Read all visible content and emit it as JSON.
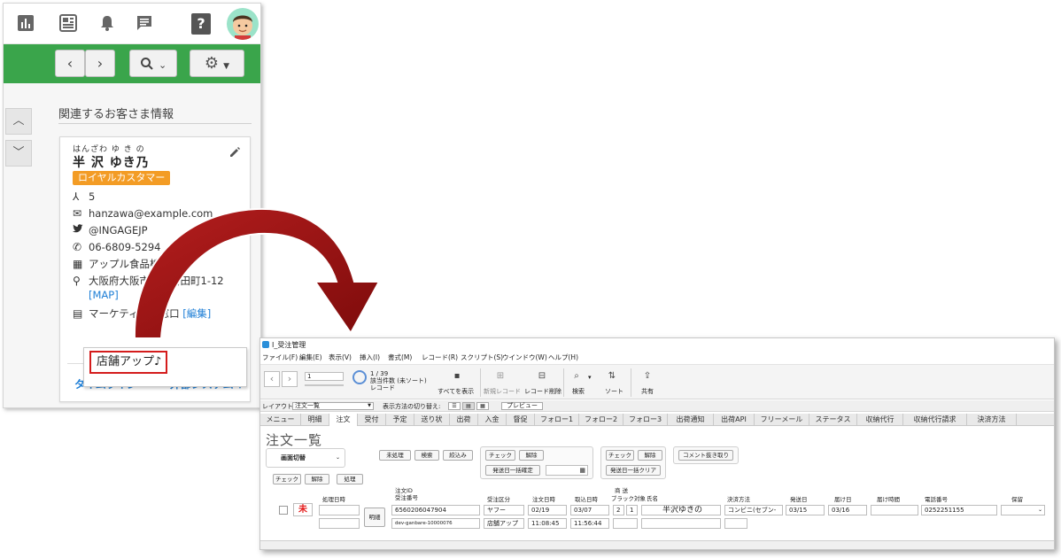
{
  "crm": {
    "help_label": "?",
    "section_title": "関連するお客さま情報",
    "customer": {
      "ruby": "はんざわ ゆ き の",
      "name": "半 沢 ゆき乃",
      "badge": "ロイヤルカスタマー",
      "count": "5",
      "email": "hanzawa@example.com",
      "twitter": "@INGAGEJP",
      "phone": "06-6809-5294",
      "company": "アップル食品株式会社",
      "address": "大阪府大阪市北区角田町1-12",
      "map_link": "[MAP]",
      "note": "マーケティング窓口",
      "edit_link": "[編集]"
    },
    "tabs": {
      "timeline": "タイムライン",
      "external": "外部システム"
    },
    "dropdown_item": "店舗アップ♪"
  },
  "fm": {
    "window_title": "I_受注管理",
    "menu": [
      "ファイル(F)",
      "編集(E)",
      "表示(V)",
      "挿入(I)",
      "書式(M)",
      "レコード(R)",
      "スクリプト(S)",
      "ウインドウ(W)",
      "ヘルプ(H)"
    ],
    "toolbar": {
      "record_value": "1",
      "count": "1 / 39",
      "found": "該当件数 (未ソート)",
      "record_label": "レコード",
      "show_all": "すべてを表示",
      "new_record": "新規レコード",
      "delete_record": "レコード削除",
      "find": "検索",
      "sort": "ソート",
      "share": "共有"
    },
    "layout_label": "レイアウト:",
    "layout_value": "注文一覧",
    "view_label": "表示方法の切り替え:",
    "preview": "プレビュー",
    "tabs": [
      "メニュー",
      "明細",
      "注文",
      "受付",
      "予定",
      "送り状",
      "出荷",
      "入金",
      "督促",
      "フォロー1",
      "フォロー2",
      "フォロー3",
      "出荷通知",
      "出荷API",
      "フリーメール",
      "ステータス",
      "収納代行",
      "収納代行請求",
      "決済方法"
    ],
    "heading": "注文一覧",
    "buttons": {
      "screen_switch": "画面切替",
      "check": "チェック",
      "release": "解除",
      "process": "処理",
      "unprocessed": "未処理",
      "search": "検索",
      "narrow": "絞込み",
      "group_check": "チェック",
      "group_release": "解除",
      "ship_date_confirm": "発送日一括確定",
      "group2_check": "チェック",
      "group2_release": "解除",
      "ship_date_clear": "発送日一括クリア",
      "comment_extract": "コメント抜き取り",
      "detail": "明細"
    },
    "headers": {
      "processed_at": "処理日時",
      "order_id": "注文ID",
      "received_no": "受注番号",
      "order_type": "受注区分",
      "order_datetime": "注文日時",
      "import_datetime": "取込日時",
      "product_top": "商 送",
      "blacklist": "ブラック対象",
      "name": "氏名",
      "payment": "決済方法",
      "ship_date": "発送日",
      "arrival_date": "届け日",
      "arrival_time": "届け時間",
      "phone": "電話番号",
      "hold": "保留"
    },
    "row": {
      "status": "未",
      "received_no": "6560206047904",
      "order_no": "dev-ganbare-10000076",
      "order_type": "ヤフー",
      "order_type2": "店舗アップ",
      "order_date": "02/19",
      "order_time": "11:08:45",
      "import_date": "03/07",
      "import_time": "11:56:44",
      "flag1": "2",
      "flag2": "1",
      "name": "半沢ゆきの",
      "payment": "コンビニ(セブン-",
      "ship_date": "03/15",
      "arrival_date": "03/16",
      "phone": "0252251155"
    }
  }
}
